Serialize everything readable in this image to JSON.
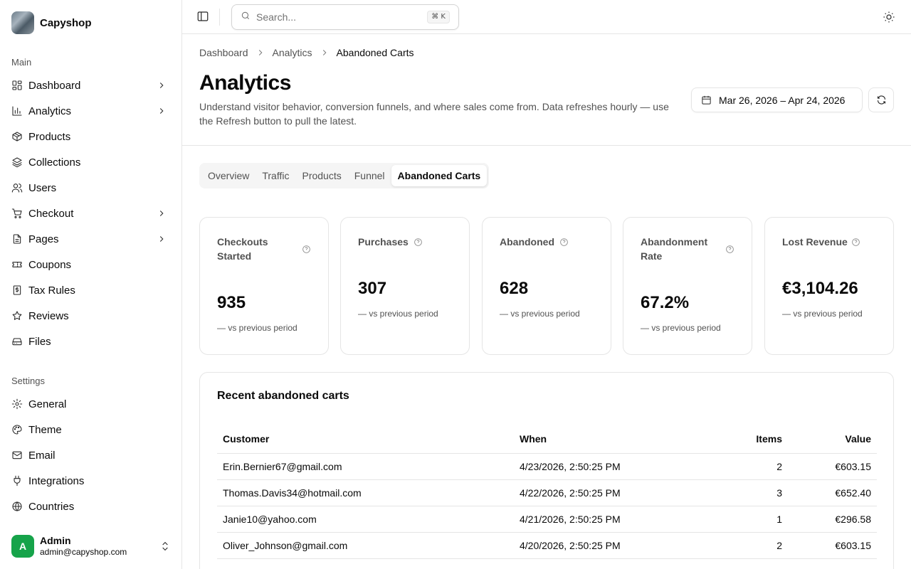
{
  "app": {
    "name": "Capyshop"
  },
  "sidebar": {
    "main_label": "Main",
    "main_items": [
      {
        "label": "Dashboard",
        "icon": "dashboard-icon",
        "expandable": true
      },
      {
        "label": "Analytics",
        "icon": "bar-chart-icon",
        "expandable": true
      },
      {
        "label": "Products",
        "icon": "package-icon",
        "expandable": false
      },
      {
        "label": "Collections",
        "icon": "layers-icon",
        "expandable": false
      },
      {
        "label": "Users",
        "icon": "users-icon",
        "expandable": false
      },
      {
        "label": "Checkout",
        "icon": "cart-icon",
        "expandable": true
      },
      {
        "label": "Pages",
        "icon": "file-icon",
        "expandable": true
      },
      {
        "label": "Coupons",
        "icon": "ticket-icon",
        "expandable": false
      },
      {
        "label": "Tax Rules",
        "icon": "receipt-icon",
        "expandable": false
      },
      {
        "label": "Reviews",
        "icon": "star-icon",
        "expandable": false
      },
      {
        "label": "Files",
        "icon": "drive-icon",
        "expandable": false
      }
    ],
    "settings_label": "Settings",
    "settings_items": [
      {
        "label": "General",
        "icon": "gear-icon"
      },
      {
        "label": "Theme",
        "icon": "palette-icon"
      },
      {
        "label": "Email",
        "icon": "mail-icon"
      },
      {
        "label": "Integrations",
        "icon": "plug-icon"
      },
      {
        "label": "Countries",
        "icon": "globe-icon"
      }
    ],
    "user": {
      "initial": "A",
      "name": "Admin",
      "email": "admin@capyshop.com",
      "avatar_color": "#16a34a"
    }
  },
  "topbar": {
    "search_placeholder": "Search...",
    "search_shortcut": "⌘ K"
  },
  "breadcrumb": [
    "Dashboard",
    "Analytics",
    "Abandoned Carts"
  ],
  "page": {
    "title": "Analytics",
    "description": "Understand visitor behavior, conversion funnels, and where sales come from. Data refreshes hourly — use the Refresh button to pull the latest.",
    "date_range": "Mar 26, 2026 – Apr 24, 2026"
  },
  "tabs": [
    {
      "label": "Overview",
      "active": false
    },
    {
      "label": "Traffic",
      "active": false
    },
    {
      "label": "Products",
      "active": false
    },
    {
      "label": "Funnel",
      "active": false
    },
    {
      "label": "Abandoned Carts",
      "active": true
    }
  ],
  "kpis": [
    {
      "label": "Checkouts Started",
      "value": "935",
      "change": "— vs previous period"
    },
    {
      "label": "Purchases",
      "value": "307",
      "change": "— vs previous period"
    },
    {
      "label": "Abandoned",
      "value": "628",
      "change": "— vs previous period"
    },
    {
      "label": "Abandonment Rate",
      "value": "67.2%",
      "change": "— vs previous period"
    },
    {
      "label": "Lost Revenue",
      "value": "€3,104.26",
      "change": "— vs previous period"
    }
  ],
  "table": {
    "title": "Recent abandoned carts",
    "columns": [
      "Customer",
      "When",
      "Items",
      "Value"
    ],
    "rows": [
      [
        "Erin.Bernier67@gmail.com",
        "4/23/2026, 2:50:25 PM",
        "2",
        "€603.15"
      ],
      [
        "Thomas.Davis34@hotmail.com",
        "4/22/2026, 2:50:25 PM",
        "3",
        "€652.40"
      ],
      [
        "Janie10@yahoo.com",
        "4/21/2026, 2:50:25 PM",
        "1",
        "€296.58"
      ],
      [
        "Oliver_Johnson@gmail.com",
        "4/20/2026, 2:50:25 PM",
        "2",
        "€603.15"
      ]
    ]
  }
}
